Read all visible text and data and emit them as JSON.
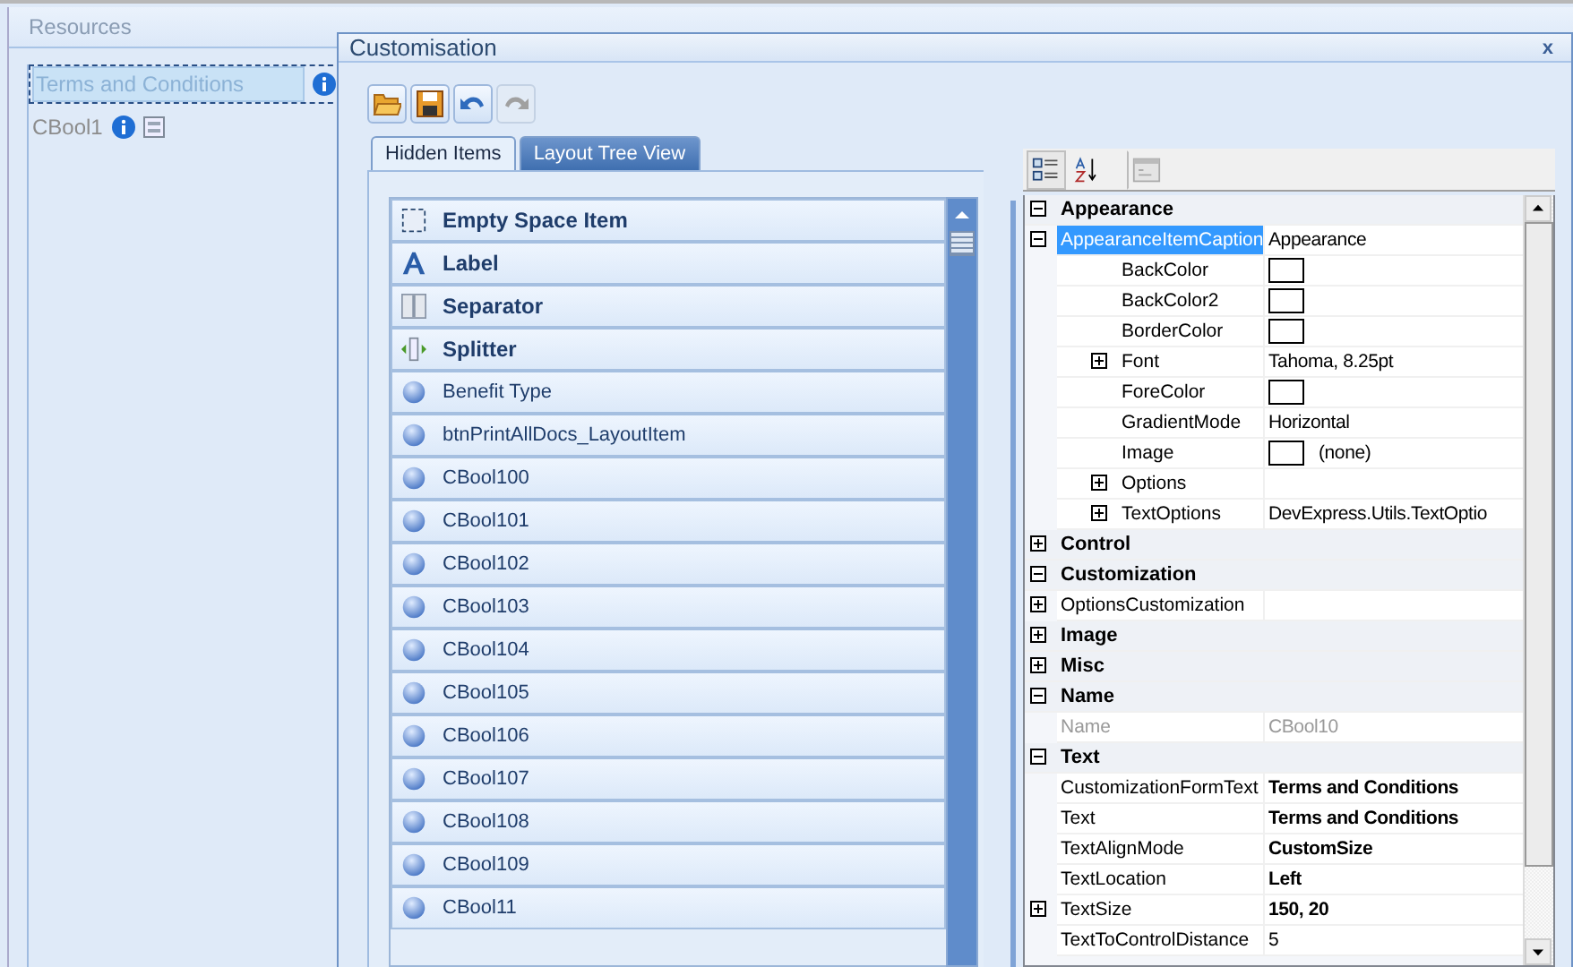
{
  "background_form": {
    "group_title": "Resources",
    "items": [
      {
        "label": "Terms and Conditions",
        "selected": true,
        "info_icon": true,
        "box_icon": false
      },
      {
        "label": "CBool1",
        "selected": false,
        "info_icon": true,
        "box_icon": true
      }
    ]
  },
  "dialog": {
    "title": "Customisation",
    "close": "x",
    "toolbar": [
      {
        "kind": "open",
        "disabled": false
      },
      {
        "kind": "save",
        "disabled": false
      },
      {
        "kind": "undo",
        "disabled": false
      },
      {
        "kind": "redo",
        "disabled": true
      }
    ],
    "tabs": [
      {
        "label": "Hidden Items",
        "selected": true
      },
      {
        "label": "Layout Tree View",
        "selected": false
      }
    ],
    "hidden_items": [
      {
        "kind": "empty-space",
        "label": "Empty Space Item"
      },
      {
        "kind": "label",
        "label": "Label"
      },
      {
        "kind": "separator",
        "label": "Separator"
      },
      {
        "kind": "splitter",
        "label": "Splitter"
      },
      {
        "kind": "item",
        "label": "Benefit Type"
      },
      {
        "kind": "item",
        "label": "btnPrintAllDocs_LayoutItem"
      },
      {
        "kind": "item",
        "label": "CBool100"
      },
      {
        "kind": "item",
        "label": "CBool101"
      },
      {
        "kind": "item",
        "label": "CBool102"
      },
      {
        "kind": "item",
        "label": "CBool103"
      },
      {
        "kind": "item",
        "label": "CBool104"
      },
      {
        "kind": "item",
        "label": "CBool105"
      },
      {
        "kind": "item",
        "label": "CBool106"
      },
      {
        "kind": "item",
        "label": "CBool107"
      },
      {
        "kind": "item",
        "label": "CBool108"
      },
      {
        "kind": "item",
        "label": "CBool109"
      },
      {
        "kind": "item",
        "label": "CBool11"
      }
    ],
    "property_toolbar": [
      {
        "kind": "categorized",
        "selected": true
      },
      {
        "kind": "alphabetical",
        "selected": false
      },
      {
        "kind": "pages",
        "selected": false
      }
    ],
    "properties": [
      {
        "label": "Appearance",
        "expanded": true,
        "children": [
          {
            "name": "AppearanceItemCaption",
            "value": "Appearance",
            "selected": true,
            "expanded": true,
            "children": [
              {
                "name": "BackColor",
                "swatch": true,
                "selected": false
              },
              {
                "name": "BackColor2",
                "swatch": true,
                "selected": false
              },
              {
                "name": "BorderColor",
                "swatch": true,
                "selected": false
              },
              {
                "name": "Font",
                "value": "Tahoma, 8.25pt",
                "expanded": false,
                "selected": false
              },
              {
                "name": "ForeColor",
                "swatch": true,
                "selected": false
              },
              {
                "name": "GradientMode",
                "value": "Horizontal",
                "selected": false
              },
              {
                "name": "Image",
                "swatch": true,
                "value": "(none)",
                "selected": false
              },
              {
                "name": "Options",
                "expanded": false,
                "selected": false
              },
              {
                "name": "TextOptions",
                "value": "DevExpress.Utils.TextOptio",
                "expanded": false,
                "selected": false
              }
            ]
          }
        ]
      },
      {
        "label": "Control",
        "expanded": false
      },
      {
        "label": "Customization",
        "expanded": true,
        "children": [
          {
            "name": "OptionsCustomization",
            "expanded": false,
            "selected": false
          }
        ]
      },
      {
        "label": "Image",
        "expanded": false
      },
      {
        "label": "Misc",
        "expanded": false
      },
      {
        "label": "Name",
        "expanded": true,
        "children": [
          {
            "name": "Name",
            "value": "CBool10",
            "disabled": true,
            "selected": false
          }
        ]
      },
      {
        "label": "Text",
        "expanded": true,
        "children": [
          {
            "name": "CustomizationFormText",
            "value": "Terms and Conditions",
            "modified": true,
            "selected": false
          },
          {
            "name": "Text",
            "value": "Terms and Conditions",
            "modified": true,
            "selected": false
          },
          {
            "name": "TextAlignMode",
            "value": "CustomSize",
            "modified": true,
            "selected": false
          },
          {
            "name": "TextLocation",
            "value": "Left",
            "modified": true,
            "selected": false
          },
          {
            "name": "TextSize",
            "value": "150, 20",
            "modified": true,
            "expanded": false,
            "selected": false
          },
          {
            "name": "TextToControlDistance",
            "value": "5",
            "selected": false
          }
        ]
      }
    ]
  }
}
